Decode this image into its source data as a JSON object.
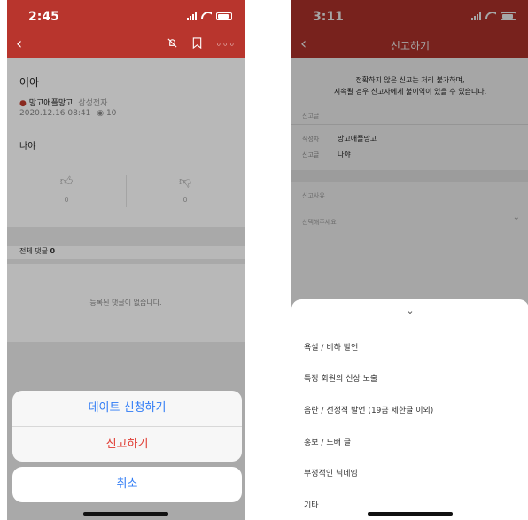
{
  "left": {
    "status": {
      "time": "2:45"
    },
    "post": {
      "title": "어아",
      "author": "망고애플망고",
      "company": "삼성전자",
      "date": "2020.12.16 08:41",
      "views": "10",
      "body": "나야"
    },
    "votes": {
      "like": "0",
      "dislike": "0"
    },
    "comments": {
      "label": "전체 댓글",
      "count": "0",
      "empty": "등록된 댓글이 없습니다."
    },
    "action_sheet": {
      "date_request": "데이트 신청하기",
      "report": "신고하기",
      "cancel": "취소"
    }
  },
  "right": {
    "status": {
      "time": "3:11"
    },
    "title": "신고하기",
    "notice_line1": "정확하지 않은 신고는 처리 불가하며,",
    "notice_line2": "지속될 경우 신고자에게 불이익이 있을 수 있습니다.",
    "section_report_post": "신고글",
    "author_label": "작성자",
    "author_value": "망고애플망고",
    "post_label": "신고글",
    "post_value": "나야",
    "section_reason": "신고사유",
    "select_placeholder": "선택해주세요",
    "options": [
      "욕설 / 비하 발언",
      "특정 회원의 신상 노출",
      "음란 / 선정적 발언 (19금 제한글 이외)",
      "홍보 / 도배 글",
      "부정적인 닉네임",
      "기타"
    ]
  },
  "colors": {
    "brand": "#b8352d",
    "link_blue": "#2f7bf5",
    "destructive_red": "#e03b32"
  }
}
